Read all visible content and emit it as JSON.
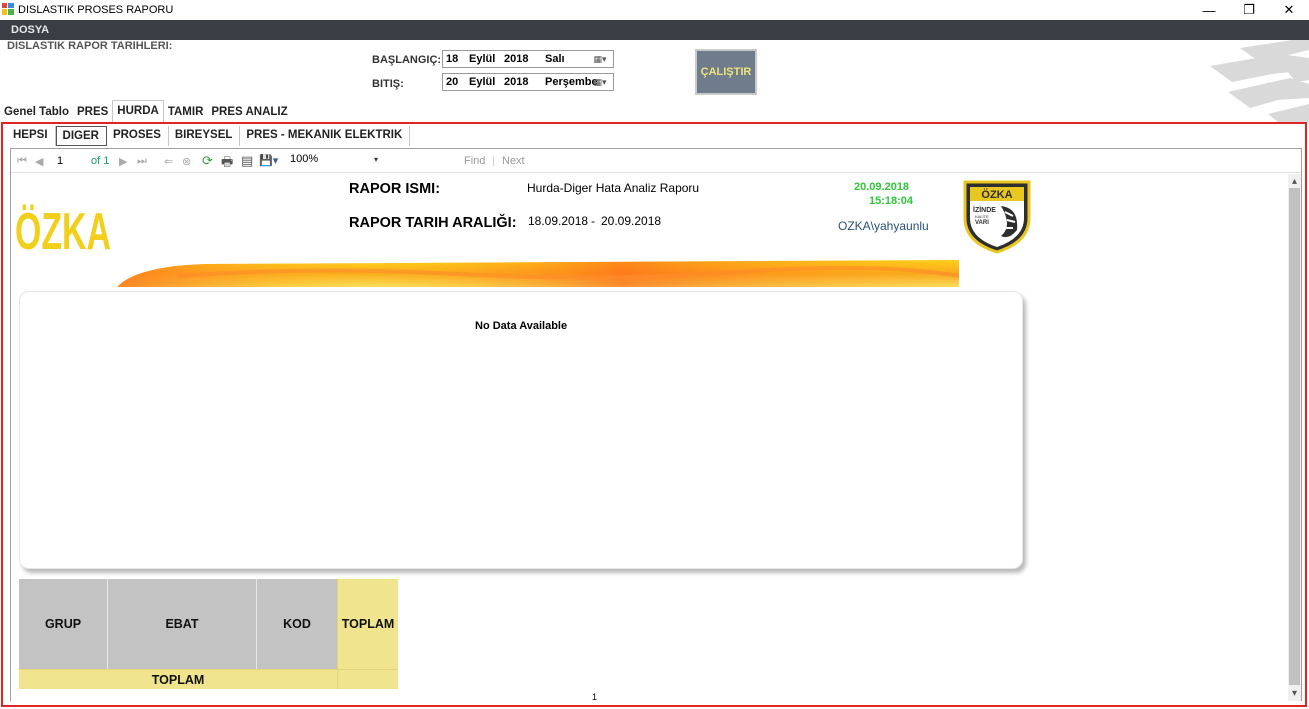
{
  "window": {
    "title": "DISLASTIK PROSES RAPORU",
    "minimize_glyph": "—",
    "maximize_glyph": "❐",
    "close_glyph": "✕"
  },
  "menu": {
    "dosya": "DOSYA"
  },
  "header": {
    "title": "DISLASTIK RAPOR TARIHLERI:",
    "start_label": "BAŞLANGIÇ:",
    "end_label": "BITIŞ:",
    "start_date": {
      "day": "18",
      "month": "Eylül",
      "year": "2018",
      "weekday": "Salı"
    },
    "end_date": {
      "day": "20",
      "month": "Eylül",
      "year": "2018",
      "weekday": "Perşembe"
    },
    "calendar_glyph": "▦▾",
    "run_button": "ÇALIŞTIR"
  },
  "main_tabs": [
    "Genel Tablo",
    "PRES",
    "HURDA",
    "TAMIR",
    "PRES ANALIZ"
  ],
  "main_tab_active": "HURDA",
  "sub_tabs": [
    "HEPSI",
    "DIGER",
    "PROSES",
    "BIREYSEL",
    "PRES - MEKANIK ELEKTRIK"
  ],
  "sub_tab_active": "DIGER",
  "toolbar": {
    "page": "1",
    "of": "of 1",
    "zoom": "100%",
    "find": "Find",
    "sep": "|",
    "next": "Next",
    "glyphs": {
      "first": "⏮",
      "prev": "◀",
      "next": "▶",
      "last": "⏭",
      "back": "⇐",
      "stop": "⊗",
      "refresh": "⟳",
      "print": "🖶",
      "layout": "▤",
      "export": "💾▾",
      "dropdown": "▾"
    }
  },
  "report": {
    "logo_text": "ÖZKA",
    "name_label": "RAPOR ISMI:",
    "name_value": "Hurda-Diger Hata Analiz Raporu",
    "range_label": "RAPOR TARIH ARALIĞI:",
    "range_start": "18.09.2018",
    "range_sep": "-",
    "range_end": "20.09.2018",
    "print_date": "20.09.2018",
    "print_time": "15:18:04",
    "user": "OZKA\\yahyaunlu",
    "badge_title": "ÖZKA",
    "badge_line1": "İZİNDE",
    "badge_line2": "KALİTE",
    "badge_line3": "VARI",
    "no_data": "No Data Available",
    "matrix": {
      "grup": "GRUP",
      "ebat": "EBAT",
      "kod": "KOD",
      "toplam_header": "TOPLAM",
      "toplam_row": "TOPLAM"
    },
    "page_number": "1"
  },
  "scrollbar": {
    "up": "▴",
    "down": "▾"
  },
  "colors": {
    "menubar": "#3b3f45",
    "frame_border": "#e02424",
    "run_button_bg": "#6e7c8c",
    "run_button_text": "#f0e27a",
    "logo_yellow": "#f2cf1a",
    "green_text": "#2ec83a",
    "matrix_gray": "#c3c3c3",
    "matrix_yellow": "#f0e48f"
  }
}
